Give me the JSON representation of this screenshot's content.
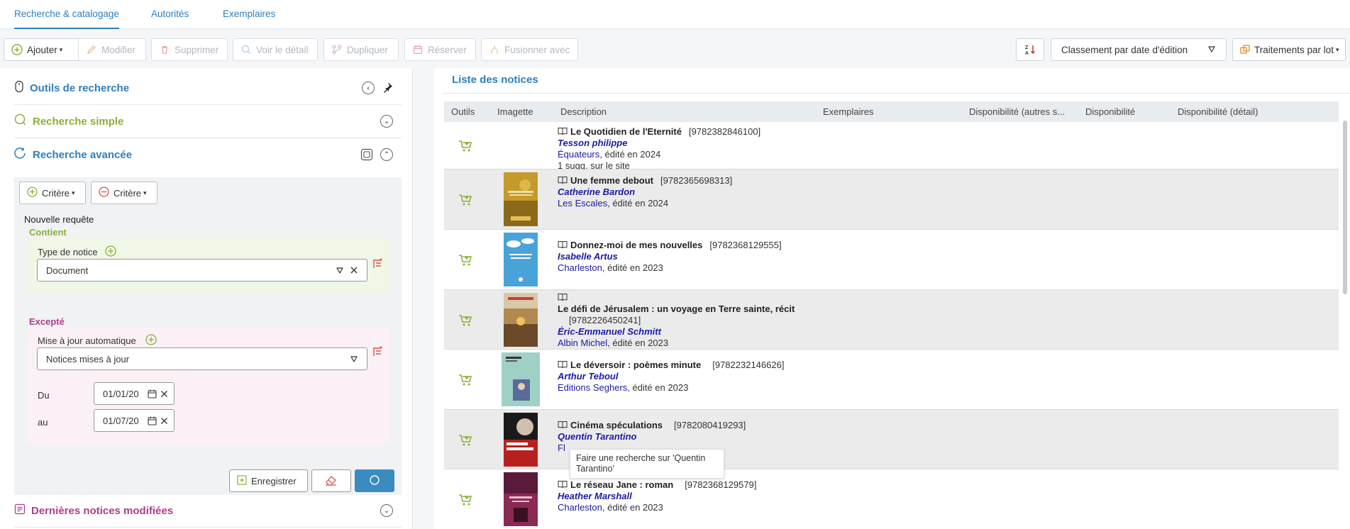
{
  "tabs": [
    {
      "label": "Recherche & catalogage",
      "active": true
    },
    {
      "label": "Autorités",
      "active": false
    },
    {
      "label": "Exemplaires",
      "active": false
    }
  ],
  "toolbar": {
    "add": "Ajouter",
    "edit": "Modifier",
    "delete": "Supprimer",
    "detail": "Voir le détail",
    "duplicate": "Dupliquer",
    "reserve": "Réserver",
    "merge": "Fusionner avec",
    "sort": "Classement par date d'édition",
    "batch": "Traitements par lot"
  },
  "left": {
    "tools_title": "Outils de recherche",
    "simple_title": "Recherche simple",
    "advanced_title": "Recherche avancée",
    "last_modified_title": "Dernières notices modifiées",
    "add_criteria": "Critère",
    "remove_criteria": "Critère",
    "new_query": "Nouvelle requête",
    "contains": "Contient",
    "notice_type_label": "Type de notice",
    "notice_type_value": "Document",
    "except": "Excepté",
    "auto_update_label": "Mise à jour automatique",
    "auto_update_value": "Notices mises à jour",
    "from_label": "Du",
    "from_value": "01/01/20",
    "to_label": "au",
    "to_value": "01/07/20",
    "save": "Enregistrer"
  },
  "list": {
    "title": "Liste des notices",
    "columns": [
      "Outils",
      "Imagette",
      "Description",
      "Exemplaires",
      "Disponibilité (autres s...",
      "Disponibilité",
      "Disponibilité (détail)"
    ],
    "rows": [
      {
        "title": "Le Quotidien de l'Eternité",
        "isbn": "[9782382846100]",
        "author": "Tesson philippe",
        "publisher": "Équateurs",
        "edition": ", édité en 2024",
        "extra": "1 sugg. sur le site",
        "has_thumb": false
      },
      {
        "title": "Une femme debout",
        "isbn": "[9782365698313]",
        "author": "Catherine Bardon",
        "publisher": "Les Escales",
        "edition": ", édité en 2024",
        "extra": "",
        "has_thumb": true,
        "thumb_color": "#c49a2a"
      },
      {
        "title": "Donnez-moi de mes nouvelles",
        "isbn": "[9782368129555]",
        "author": "Isabelle Artus",
        "publisher": "Charleston",
        "edition": ", édité en 2023",
        "extra": "",
        "has_thumb": true,
        "thumb_color": "#4aa3d8"
      },
      {
        "title": "Le défi de Jérusalem : un voyage en Terre sainte, récit",
        "isbn": "[9782226450241]",
        "author": "Éric-Emmanuel Schmitt",
        "publisher": "Albin Michel",
        "edition": ", édité en 2023",
        "extra": "",
        "has_thumb": true,
        "thumb_color": "#8a6a3a"
      },
      {
        "title": "Le déversoir : poèmes minute",
        "isbn": "[9782232146626]",
        "author": "Arthur Teboul",
        "publisher": "Editions Seghers",
        "edition": ", édité en 2023",
        "extra": "",
        "has_thumb": true,
        "thumb_color": "#6fb0a5"
      },
      {
        "title": "Cinéma spéculations",
        "isbn": "[9782080419293]",
        "author": "Quentin Tarantino",
        "publisher": "Fl",
        "edition": "",
        "extra": "",
        "has_thumb": true,
        "thumb_color": "#b8201e"
      },
      {
        "title": "Le réseau Jane : roman",
        "isbn": "[9782368129579]",
        "author": "Heather Marshall",
        "publisher": "Charleston",
        "edition": ", édité en 2023",
        "extra": "",
        "has_thumb": true,
        "thumb_color": "#8a2a55"
      }
    ],
    "tooltip": "Faire une recherche sur 'Quentin Tarantino'"
  },
  "colors": {
    "primary_blue": "#2e7fbf",
    "green": "#8bb036",
    "purple": "#b23b8c",
    "red": "#d9534f",
    "link_blue": "#1a1aa6"
  }
}
